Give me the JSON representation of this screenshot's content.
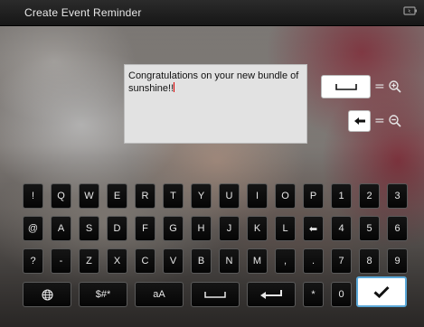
{
  "window": {
    "title": "Create Event Reminder",
    "power_icon": "battery-plug-icon"
  },
  "editor": {
    "text": "Congratulations on your new bundle of sunshine!!",
    "caret_color": "#dd0000"
  },
  "side_controls": {
    "space_label": "=",
    "backspace_label": "=",
    "zoom_in_icon": "zoom-in-icon",
    "zoom_out_icon": "zoom-out-icon"
  },
  "keyboard": {
    "rows": [
      [
        "!",
        "Q",
        "W",
        "E",
        "R",
        "T",
        "Y",
        "U",
        "I",
        "O",
        "P",
        "1",
        "2",
        "3"
      ],
      [
        "@",
        "A",
        "S",
        "D",
        "F",
        "G",
        "H",
        "J",
        "K",
        "L",
        "⬅",
        "4",
        "5",
        "6"
      ],
      [
        "?",
        "-",
        "Z",
        "X",
        "C",
        "V",
        "B",
        "N",
        "M",
        ",",
        ".",
        "7",
        "8",
        "9"
      ]
    ],
    "bottom_row": {
      "globe": "globe-icon",
      "symbols": "$#*",
      "case": "aA",
      "space": "space-icon",
      "enter": "enter-icon",
      "star": "*",
      "zero": "0",
      "ok": "checkmark-icon"
    }
  },
  "colors": {
    "titlebar": "#1c1c1c",
    "key_bg": "#0c0c0c",
    "key_border": "#5a5a5a",
    "ok_border": "#5aa8d8",
    "editor_bg": "#e2e2e2"
  }
}
